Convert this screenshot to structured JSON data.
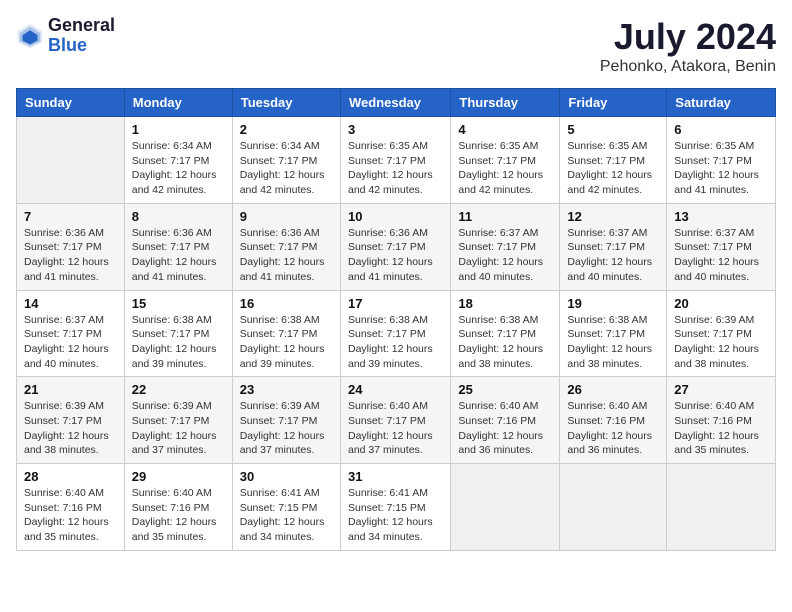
{
  "logo": {
    "general": "General",
    "blue": "Blue"
  },
  "title": "July 2024",
  "location": "Pehonko, Atakora, Benin",
  "days_header": [
    "Sunday",
    "Monday",
    "Tuesday",
    "Wednesday",
    "Thursday",
    "Friday",
    "Saturday"
  ],
  "weeks": [
    [
      {
        "num": "",
        "info": ""
      },
      {
        "num": "1",
        "info": "Sunrise: 6:34 AM\nSunset: 7:17 PM\nDaylight: 12 hours\nand 42 minutes."
      },
      {
        "num": "2",
        "info": "Sunrise: 6:34 AM\nSunset: 7:17 PM\nDaylight: 12 hours\nand 42 minutes."
      },
      {
        "num": "3",
        "info": "Sunrise: 6:35 AM\nSunset: 7:17 PM\nDaylight: 12 hours\nand 42 minutes."
      },
      {
        "num": "4",
        "info": "Sunrise: 6:35 AM\nSunset: 7:17 PM\nDaylight: 12 hours\nand 42 minutes."
      },
      {
        "num": "5",
        "info": "Sunrise: 6:35 AM\nSunset: 7:17 PM\nDaylight: 12 hours\nand 42 minutes."
      },
      {
        "num": "6",
        "info": "Sunrise: 6:35 AM\nSunset: 7:17 PM\nDaylight: 12 hours\nand 41 minutes."
      }
    ],
    [
      {
        "num": "7",
        "info": "Sunrise: 6:36 AM\nSunset: 7:17 PM\nDaylight: 12 hours\nand 41 minutes."
      },
      {
        "num": "8",
        "info": "Sunrise: 6:36 AM\nSunset: 7:17 PM\nDaylight: 12 hours\nand 41 minutes."
      },
      {
        "num": "9",
        "info": "Sunrise: 6:36 AM\nSunset: 7:17 PM\nDaylight: 12 hours\nand 41 minutes."
      },
      {
        "num": "10",
        "info": "Sunrise: 6:36 AM\nSunset: 7:17 PM\nDaylight: 12 hours\nand 41 minutes."
      },
      {
        "num": "11",
        "info": "Sunrise: 6:37 AM\nSunset: 7:17 PM\nDaylight: 12 hours\nand 40 minutes."
      },
      {
        "num": "12",
        "info": "Sunrise: 6:37 AM\nSunset: 7:17 PM\nDaylight: 12 hours\nand 40 minutes."
      },
      {
        "num": "13",
        "info": "Sunrise: 6:37 AM\nSunset: 7:17 PM\nDaylight: 12 hours\nand 40 minutes."
      }
    ],
    [
      {
        "num": "14",
        "info": "Sunrise: 6:37 AM\nSunset: 7:17 PM\nDaylight: 12 hours\nand 40 minutes."
      },
      {
        "num": "15",
        "info": "Sunrise: 6:38 AM\nSunset: 7:17 PM\nDaylight: 12 hours\nand 39 minutes."
      },
      {
        "num": "16",
        "info": "Sunrise: 6:38 AM\nSunset: 7:17 PM\nDaylight: 12 hours\nand 39 minutes."
      },
      {
        "num": "17",
        "info": "Sunrise: 6:38 AM\nSunset: 7:17 PM\nDaylight: 12 hours\nand 39 minutes."
      },
      {
        "num": "18",
        "info": "Sunrise: 6:38 AM\nSunset: 7:17 PM\nDaylight: 12 hours\nand 38 minutes."
      },
      {
        "num": "19",
        "info": "Sunrise: 6:38 AM\nSunset: 7:17 PM\nDaylight: 12 hours\nand 38 minutes."
      },
      {
        "num": "20",
        "info": "Sunrise: 6:39 AM\nSunset: 7:17 PM\nDaylight: 12 hours\nand 38 minutes."
      }
    ],
    [
      {
        "num": "21",
        "info": "Sunrise: 6:39 AM\nSunset: 7:17 PM\nDaylight: 12 hours\nand 38 minutes."
      },
      {
        "num": "22",
        "info": "Sunrise: 6:39 AM\nSunset: 7:17 PM\nDaylight: 12 hours\nand 37 minutes."
      },
      {
        "num": "23",
        "info": "Sunrise: 6:39 AM\nSunset: 7:17 PM\nDaylight: 12 hours\nand 37 minutes."
      },
      {
        "num": "24",
        "info": "Sunrise: 6:40 AM\nSunset: 7:17 PM\nDaylight: 12 hours\nand 37 minutes."
      },
      {
        "num": "25",
        "info": "Sunrise: 6:40 AM\nSunset: 7:16 PM\nDaylight: 12 hours\nand 36 minutes."
      },
      {
        "num": "26",
        "info": "Sunrise: 6:40 AM\nSunset: 7:16 PM\nDaylight: 12 hours\nand 36 minutes."
      },
      {
        "num": "27",
        "info": "Sunrise: 6:40 AM\nSunset: 7:16 PM\nDaylight: 12 hours\nand 35 minutes."
      }
    ],
    [
      {
        "num": "28",
        "info": "Sunrise: 6:40 AM\nSunset: 7:16 PM\nDaylight: 12 hours\nand 35 minutes."
      },
      {
        "num": "29",
        "info": "Sunrise: 6:40 AM\nSunset: 7:16 PM\nDaylight: 12 hours\nand 35 minutes."
      },
      {
        "num": "30",
        "info": "Sunrise: 6:41 AM\nSunset: 7:15 PM\nDaylight: 12 hours\nand 34 minutes."
      },
      {
        "num": "31",
        "info": "Sunrise: 6:41 AM\nSunset: 7:15 PM\nDaylight: 12 hours\nand 34 minutes."
      },
      {
        "num": "",
        "info": ""
      },
      {
        "num": "",
        "info": ""
      },
      {
        "num": "",
        "info": ""
      }
    ]
  ]
}
